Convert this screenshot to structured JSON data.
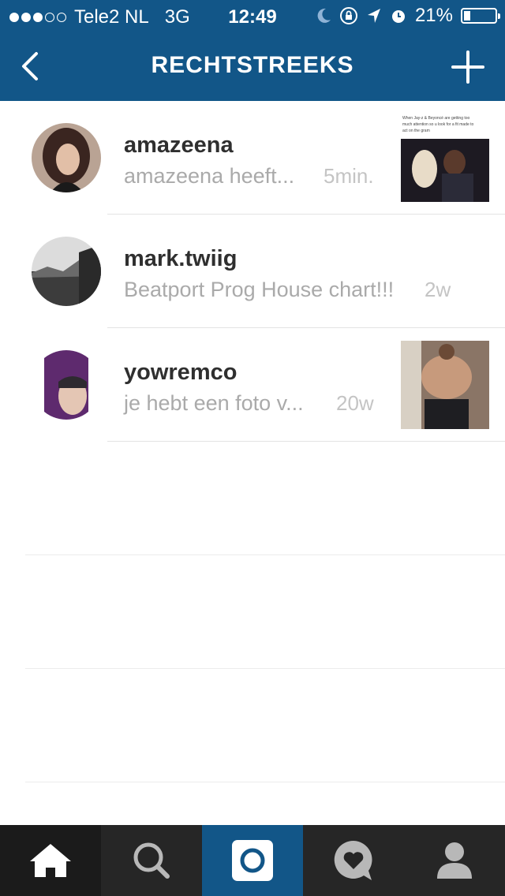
{
  "status_bar": {
    "carrier": "Tele2 NL",
    "network": "3G",
    "time": "12:49",
    "battery": "21%",
    "signal_bars_filled": 3,
    "signal_bars_total": 5
  },
  "header": {
    "title": "RECHTSTREEKS",
    "back_icon": "chevron-left-icon",
    "new_icon": "plus-icon"
  },
  "threads": [
    {
      "username": "amazeena",
      "preview": "amazeena heeft...",
      "time_ago": "5min.",
      "has_thumbnail": true
    },
    {
      "username": "mark.twiig",
      "preview": "Beatport Prog House chart!!!",
      "time_ago": "2w",
      "has_thumbnail": false
    },
    {
      "username": "yowremco",
      "preview": "je hebt een foto v...",
      "time_ago": "20w",
      "has_thumbnail": true
    }
  ],
  "thumbnail_caption": "When Jay-z & Beyoncé are getting too much attention so u look for a fit made to act on the gram",
  "tabbar": [
    {
      "icon": "home-icon",
      "active": true
    },
    {
      "icon": "search-icon",
      "active": false
    },
    {
      "icon": "camera-icon",
      "active": false
    },
    {
      "icon": "activity-heart-icon",
      "active": false
    },
    {
      "icon": "profile-icon",
      "active": false
    }
  ],
  "colors": {
    "brand_blue": "#125688",
    "tabbar_bg": "#262626"
  }
}
